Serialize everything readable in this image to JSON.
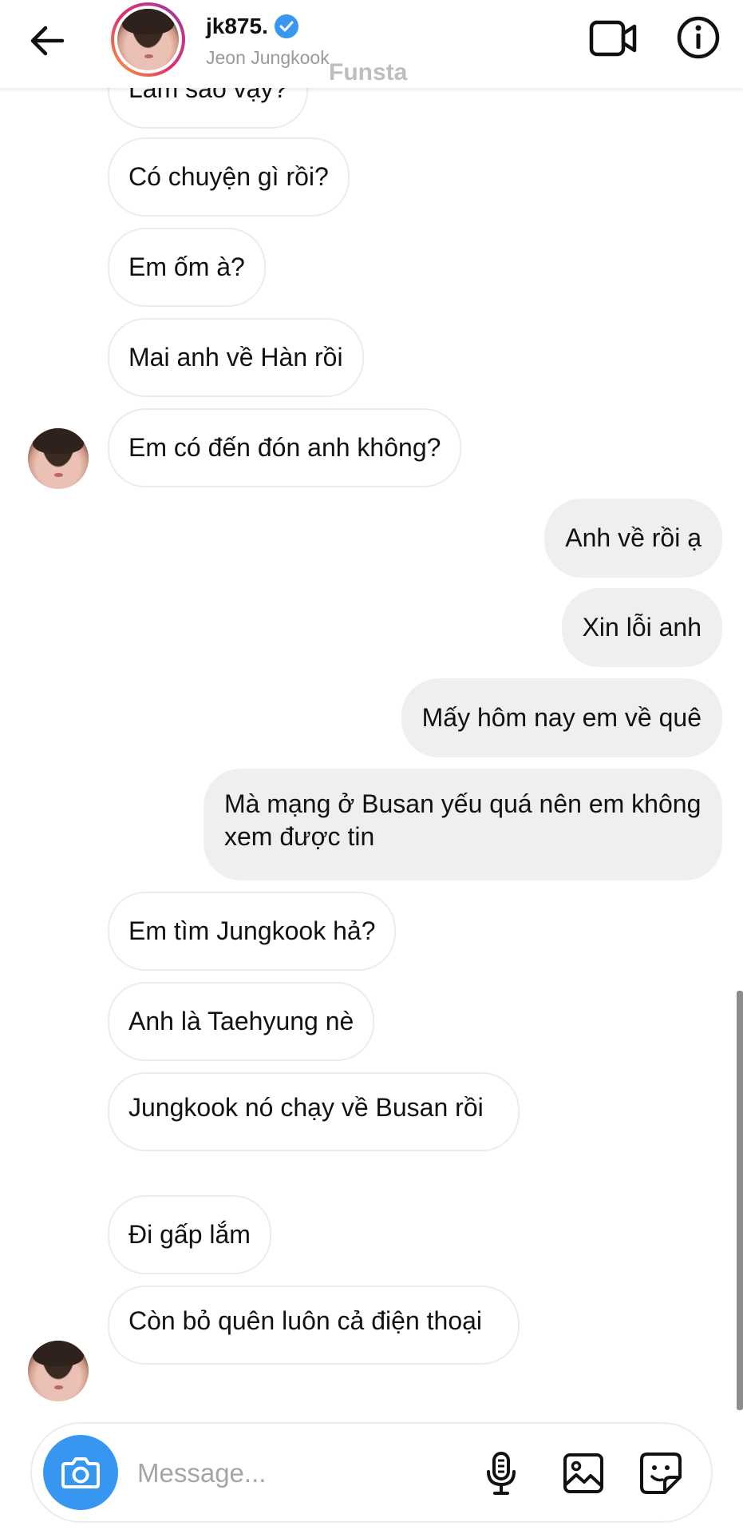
{
  "header": {
    "username": "jk875.",
    "display_name": "Jeon Jungkook",
    "watermark": "Funsta",
    "back_icon": "arrow-left-icon",
    "video_icon": "video-call-icon",
    "info_icon": "info-icon",
    "verified_icon": "verified-badge-icon"
  },
  "messages": [
    {
      "from": "them",
      "text": "Làm sao vậy?"
    },
    {
      "from": "them",
      "text": "Có chuyện gì rồi?"
    },
    {
      "from": "them",
      "text": "Em ốm à?"
    },
    {
      "from": "them",
      "text": "Mai anh về Hàn rồi"
    },
    {
      "from": "them",
      "text": "Em có đến đón anh không?"
    },
    {
      "from": "me",
      "text": "Anh về rồi ạ"
    },
    {
      "from": "me",
      "text": "Xin lỗi anh"
    },
    {
      "from": "me",
      "text": "Mấy hôm nay em về quê"
    },
    {
      "from": "me",
      "text": "Mà mạng ở Busan yếu quá nên em không xem được tin"
    },
    {
      "from": "them",
      "text": "Em tìm Jungkook hả?"
    },
    {
      "from": "them",
      "text": "Anh là Taehyung nè"
    },
    {
      "from": "them",
      "text": "Jungkook nó chạy về Busan rồi"
    },
    {
      "from": "them",
      "text": "Đi gấp lắm"
    },
    {
      "from": "them",
      "text": "Còn bỏ quên luôn cả điện thoại"
    }
  ],
  "composer": {
    "placeholder": "Message...",
    "value": "",
    "camera_icon": "camera-icon",
    "mic_icon": "microphone-icon",
    "gallery_icon": "image-gallery-icon",
    "sticker_icon": "sticker-icon"
  },
  "colors": {
    "accent": "#3797f0",
    "outgoing_bubble": "#efefef",
    "incoming_border": "#ececec",
    "muted_text": "#9a9a9a"
  }
}
